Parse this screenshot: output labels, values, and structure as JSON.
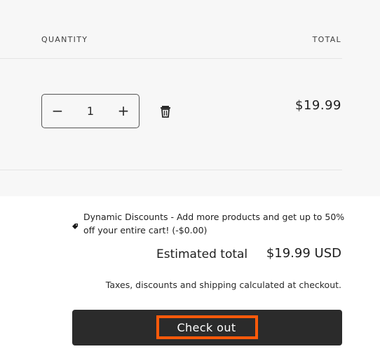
{
  "columns": {
    "quantity": "QUANTITY",
    "total": "TOTAL"
  },
  "line_item": {
    "quantity": "1",
    "decrease_symbol": "−",
    "increase_symbol": "+",
    "remove_icon": "trash-icon",
    "price": "$19.99"
  },
  "summary": {
    "discount_icon": "tag-icon",
    "discount_message": "Dynamic Discounts - Add more products and get up to 50% off your entire cart! (-$0.00)",
    "estimated_total_label": "Estimated total",
    "estimated_total_value": "$19.99 USD",
    "tax_note": "Taxes, discounts and shipping calculated at checkout.",
    "checkout_label": "Check out"
  },
  "colors": {
    "checkout_button": "#2b2b2b",
    "highlight": "#ff5a0a",
    "cart_background": "#f7f7f7"
  }
}
